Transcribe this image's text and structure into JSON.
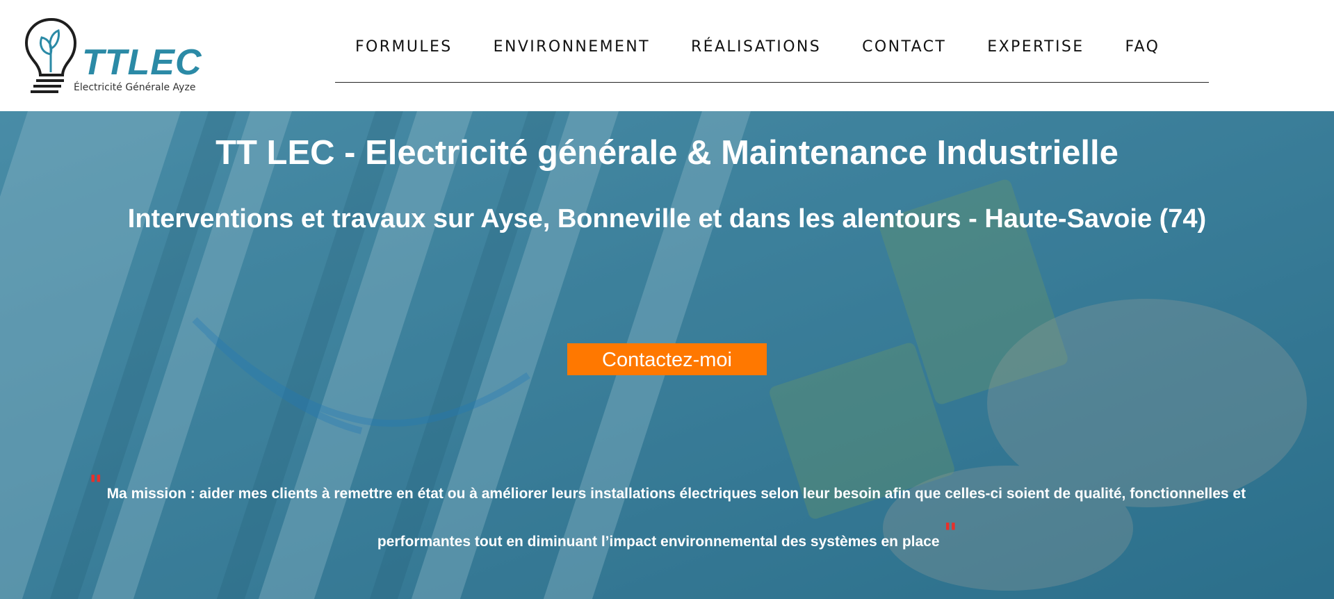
{
  "logo": {
    "name": "TTLEC",
    "tagline": "Électricité Générale Ayze",
    "icon": "lightbulb-leaf-icon",
    "brand_color": "#2b8aa6"
  },
  "nav": {
    "items": [
      {
        "label": "FORMULES"
      },
      {
        "label": "ENVIRONNEMENT"
      },
      {
        "label": "RÉALISATIONS"
      },
      {
        "label": "CONTACT"
      },
      {
        "label": "EXPERTISE"
      },
      {
        "label": "FAQ"
      }
    ]
  },
  "hero": {
    "title": "TT LEC - Electricité générale & Maintenance Industrielle",
    "subtitle": "Interventions et travaux sur Ayse, Bonneville et dans les alentours - Haute-Savoie (74)",
    "cta_label": "Contactez-moi",
    "cta_color": "#ff7800",
    "quote_open": "\"",
    "mission": "Ma mission : aider mes clients à remettre en état ou à améliorer leurs installations électriques selon leur besoin afin que celles-ci soient de qualité, fonctionnelles et performantes tout en diminuant l’impact environnemental des systèmes en place",
    "quote_close": "\"",
    "quote_color": "#e8302a",
    "overlay_color": "#2b7896"
  }
}
